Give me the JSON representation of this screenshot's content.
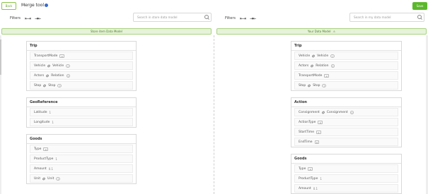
{
  "header": {
    "back_label": "Back",
    "title": "Merge tool",
    "save_label": "Save"
  },
  "left_pane": {
    "filters_label": "Filters",
    "search_placeholder": "Search in store data model",
    "model_title": "Store item Data Model",
    "entities": [
      {
        "name": "Trip",
        "fields": [
          {
            "label": "TransportMode",
            "badge": "≡"
          },
          {
            "label": "Vehicle",
            "ref": "Vehicle",
            "badge": "?"
          },
          {
            "label": "Actors",
            "ref": "Relation",
            "badge": "?"
          },
          {
            "label": "Stop",
            "ref": "Stop",
            "badge": "?"
          }
        ]
      },
      {
        "name": "GeoReference",
        "fields": [
          {
            "label": "Latitude",
            "suffix": "1"
          },
          {
            "label": "Longitude",
            "suffix": "1"
          }
        ]
      },
      {
        "name": "Goods",
        "fields": [
          {
            "label": "Type",
            "badge": "≡"
          },
          {
            "label": "ProductType",
            "suffix": "1"
          },
          {
            "label": "Amount",
            "suffix": "0.1"
          },
          {
            "label": "Unit",
            "ref": "Unit",
            "badge": "?"
          }
        ]
      }
    ]
  },
  "right_pane": {
    "filters_label": "Filters",
    "search_placeholder": "Search in my data model",
    "model_title": "Your Data Model",
    "entities": [
      {
        "name": "Trip",
        "fields": [
          {
            "label": "Vehicle",
            "ref": "Vehicle",
            "badge": "?"
          },
          {
            "label": "Actors",
            "ref": "Relation",
            "badge": "?"
          },
          {
            "label": "TransportMode",
            "badge": "≡"
          },
          {
            "label": "Stop",
            "ref": "Stop",
            "badge": "?"
          }
        ]
      },
      {
        "name": "Action",
        "fields": [
          {
            "label": "Consignment",
            "ref": "Consignment",
            "badge": "?"
          },
          {
            "label": "ActionType",
            "badge": "≡"
          },
          {
            "label": "StartTime",
            "badge": "≡"
          },
          {
            "label": "EndTime",
            "badge": "≡"
          }
        ]
      },
      {
        "name": "Goods",
        "fields": [
          {
            "label": "Type",
            "badge": "≡"
          },
          {
            "label": "ProductType",
            "suffix": "1"
          },
          {
            "label": "Amount",
            "suffix": "0.1"
          }
        ]
      }
    ]
  }
}
